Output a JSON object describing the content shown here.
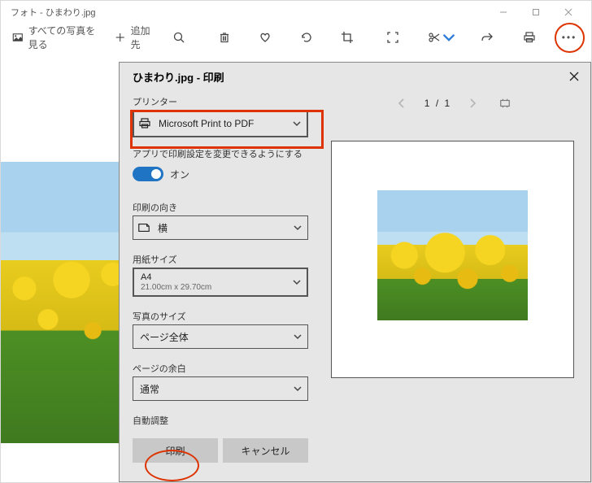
{
  "app": {
    "title": "フォト - ひまわり.jpg",
    "window_controls": {
      "min": "minimize",
      "max": "maximize",
      "close": "close"
    }
  },
  "toolbar": {
    "all_photos_label": "すべての写真を見る",
    "add_target_label": "追加先"
  },
  "print_dialog": {
    "title": "ひまわり.jpg - 印刷",
    "printer_label": "プリンター",
    "printer_value": "Microsoft Print to PDF",
    "allow_app_label": "アプリで印刷設定を変更できるようにする",
    "toggle_on_label": "オン",
    "orientation_label": "印刷の向き",
    "orientation_value": "横",
    "paper_size_label": "用紙サイズ",
    "paper_size_value": "A4",
    "paper_size_sub": "21.00cm x 29.70cm",
    "photo_size_label": "写真のサイズ",
    "photo_size_value": "ページ全体",
    "margins_label": "ページの余白",
    "margins_value": "通常",
    "auto_adjust_label": "自動調整",
    "print_button": "印刷",
    "cancel_button": "キャンセル",
    "preview": {
      "page_current": "1",
      "page_sep": "/",
      "page_total": "1"
    }
  }
}
